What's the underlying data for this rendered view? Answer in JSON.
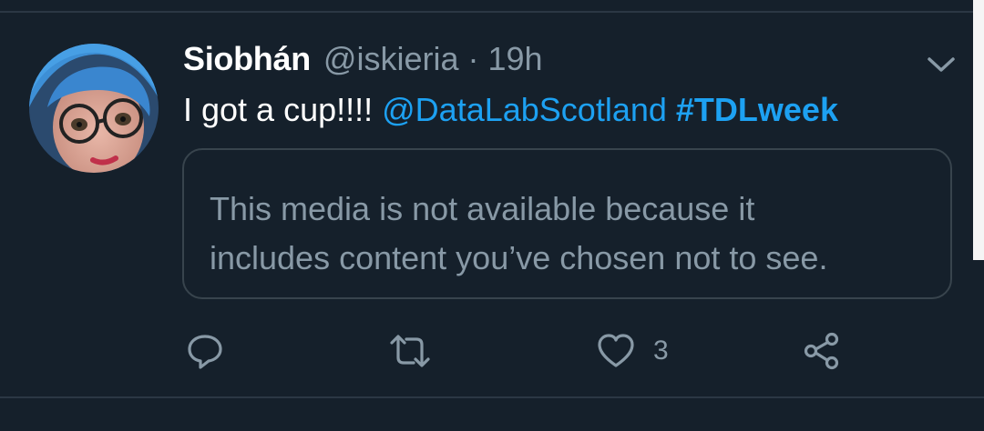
{
  "tweet": {
    "display_name": "Siobhán",
    "handle": "@iskieria",
    "separator": "·",
    "time": "19h",
    "text_plain": "I got a cup!!!! ",
    "mention": "@DataLabScotland",
    "hashtag": "#TDLweek",
    "media_notice_line1": "This media is not available because it",
    "media_notice_line2": "includes content you’ve chosen not to see."
  },
  "actions": {
    "reply_icon": "reply-icon",
    "retweet_icon": "retweet-icon",
    "like_icon": "heart-icon",
    "like_count": "3",
    "share_icon": "share-icon"
  },
  "colors": {
    "background": "#15202b",
    "text_primary": "#ffffff",
    "text_secondary": "#8899a6",
    "link": "#1da1f2",
    "border": "#38444d"
  }
}
